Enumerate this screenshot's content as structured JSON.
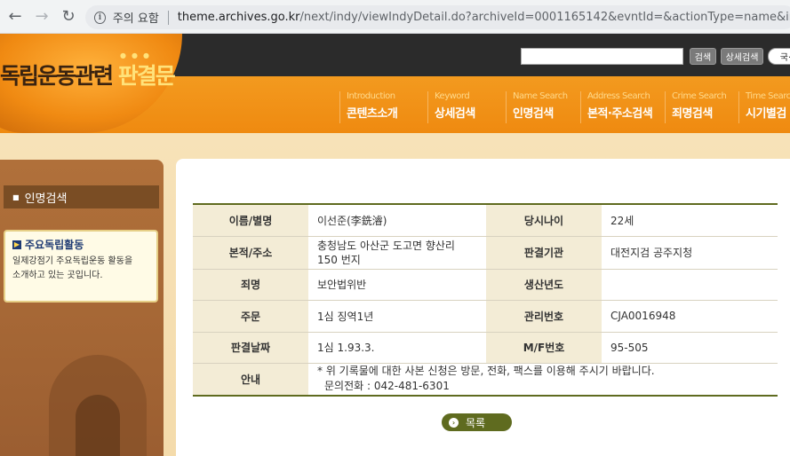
{
  "browser": {
    "info_label": "주의 요함",
    "url_host": "theme.archives.go.kr",
    "url_path": "/next/indy/viewIndyDetail.do?archiveId=0001165142&evntId=&actionType=name&in"
  },
  "header": {
    "logo_main": "독립운동관련 ",
    "logo_highlight": "판결문",
    "search_button": "검색",
    "detail_search_button": "상세검색",
    "lang_button": "국·",
    "menu": [
      {
        "en": "Introduction",
        "ko": "콘텐츠소개"
      },
      {
        "en": "Keyword",
        "ko": "상세검색"
      },
      {
        "en": "Name Search",
        "ko": "인명검색"
      },
      {
        "en": "Address Search",
        "ko": "본적·주소검색"
      },
      {
        "en": "Crime Search",
        "ko": "죄명검색"
      },
      {
        "en": "Time Search",
        "ko": "시기별검"
      }
    ]
  },
  "sidebar": {
    "title": "인명검색",
    "box_title": "주요독립활동",
    "box_text_1": "일제강점기 주요독립운동 활동을",
    "box_text_2": "소개하고 있는 곳입니다."
  },
  "record": {
    "rows": [
      {
        "l1": "이름/별명",
        "v1": "이선준(李銑濬)",
        "l2": "당시나이",
        "v2": "22세"
      },
      {
        "l1": "본적/주소",
        "v1": "충청남도 아산군 도고면 향산리 150 번지",
        "l2": "판결기관",
        "v2": "대전지검 공주지청"
      },
      {
        "l1": "죄명",
        "v1": "보안법위반",
        "l2": "생산년도",
        "v2": ""
      },
      {
        "l1": "주문",
        "v1": "1심 징역1년",
        "l2": "관리번호",
        "v2": "CJA0016948"
      },
      {
        "l1": "판결날짜",
        "v1": "1심 1.93.3.",
        "l2": "M/F번호",
        "v2": "95-505"
      }
    ],
    "note_label": "안내",
    "note_line_1": "* 위 기록물에 대한 사본 신청은 방문, 전화, 팩스를 이용해 주시기 바랍니다.",
    "note_line_2": "문의전화 : 042-481-6301"
  },
  "list_button": "목록"
}
